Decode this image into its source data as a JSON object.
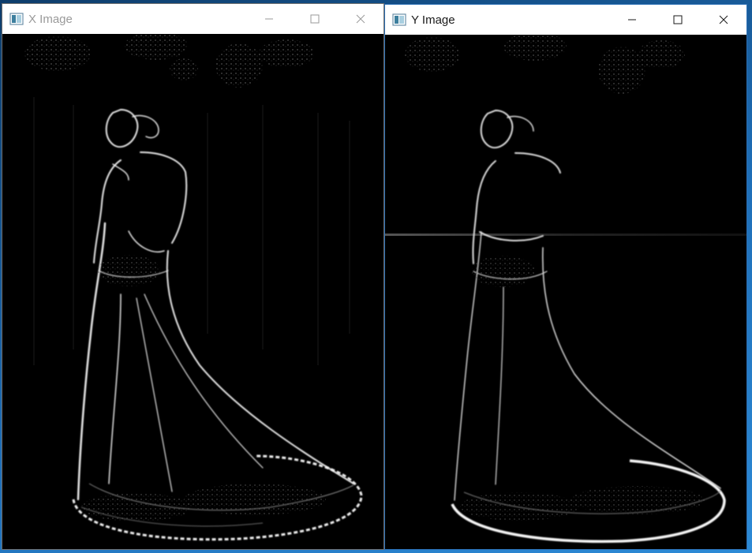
{
  "windows": [
    {
      "title": "X Image",
      "active": false,
      "controls": {
        "minimize": "minimize-icon",
        "maximize": "maximize-icon",
        "close": "close-icon"
      }
    },
    {
      "title": "Y Image",
      "active": true,
      "controls": {
        "minimize": "minimize-icon",
        "maximize": "maximize-icon",
        "close": "close-icon"
      }
    }
  ],
  "colors": {
    "desktop": "#1b5c97",
    "titlebar": "#ffffff",
    "inactive_title_text": "#9a9a9a",
    "active_title_text": "#1a1a1a",
    "image_background": "#000000",
    "edge_highlight": "#e8e8e8"
  }
}
